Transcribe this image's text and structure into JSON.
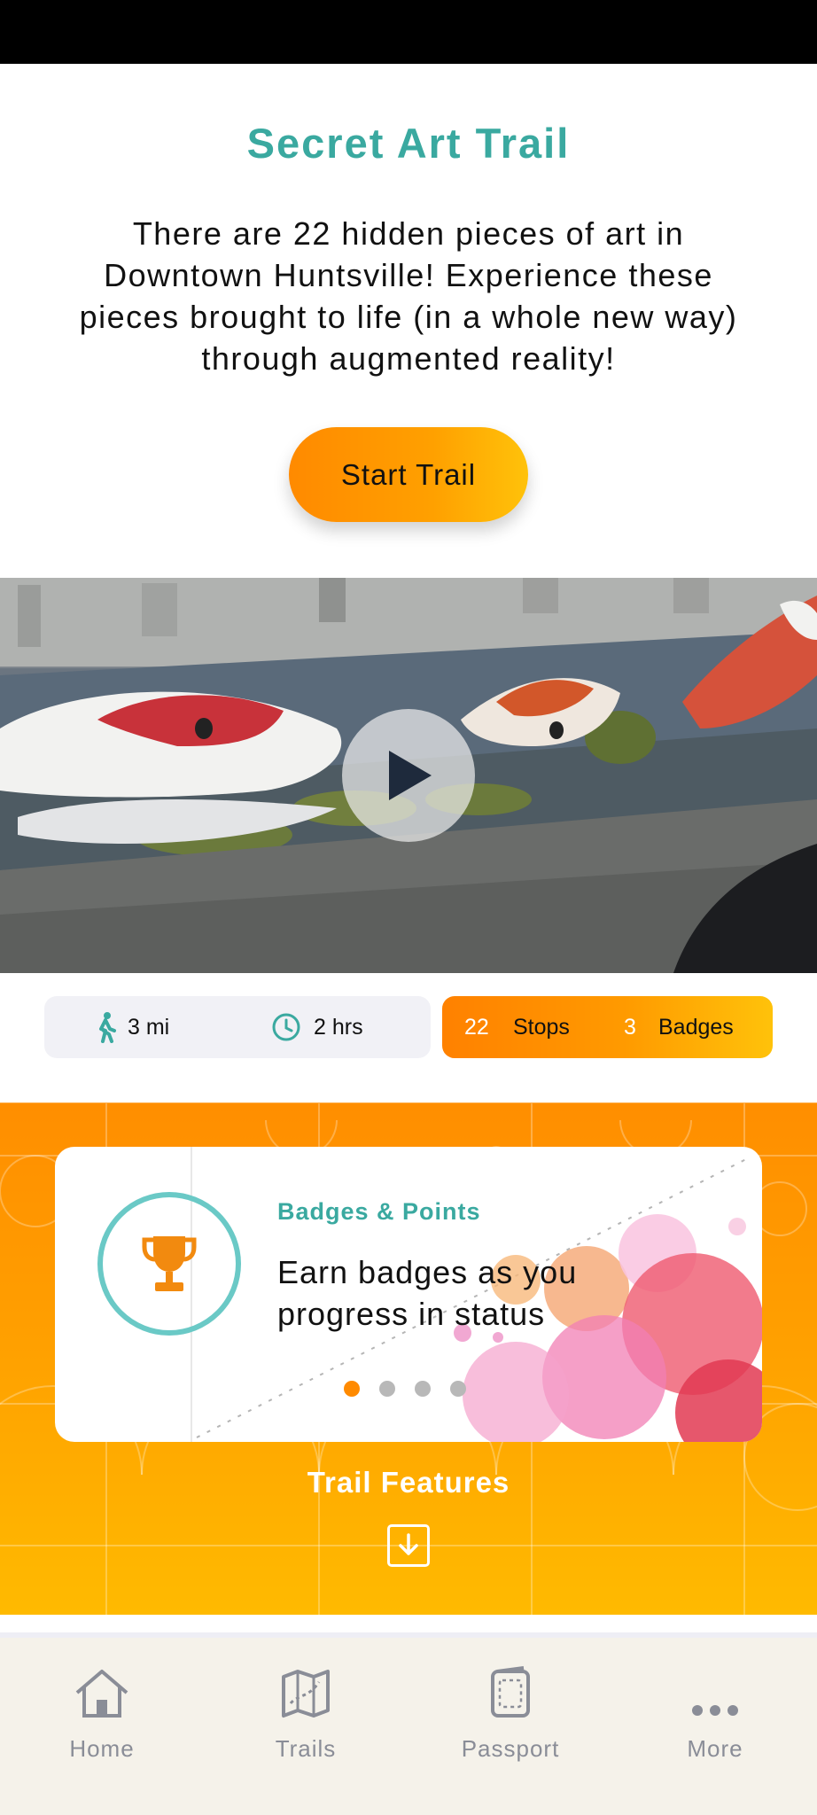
{
  "header": {
    "title": "Secret Art Trail",
    "intro": "There are 22 hidden pieces of art in Downtown Huntsville! Experience these pieces brought to life (in a whole new way) through augmented reality!",
    "start_label": "Start Trail"
  },
  "stats": {
    "distance": "3 mi",
    "duration": "2 hrs",
    "stops_count": "22",
    "stops_label": "Stops",
    "badges_count": "3",
    "badges_label": "Badges"
  },
  "feature_card": {
    "label": "Badges & Points",
    "text": "Earn badges as you progress in status",
    "pages": 4,
    "active_page": 1
  },
  "features": {
    "title": "Trail Features"
  },
  "nav": {
    "items": [
      {
        "label": "Home",
        "icon": "home-icon"
      },
      {
        "label": "Trails",
        "icon": "map-icon"
      },
      {
        "label": "Passport",
        "icon": "passport-icon"
      },
      {
        "label": "More",
        "icon": "more-icon"
      }
    ]
  },
  "colors": {
    "accent_teal": "#3aa9a0",
    "accent_orange": "#ff8a00",
    "accent_yellow": "#ffc20a",
    "nav_bg": "#f5f2ea"
  }
}
